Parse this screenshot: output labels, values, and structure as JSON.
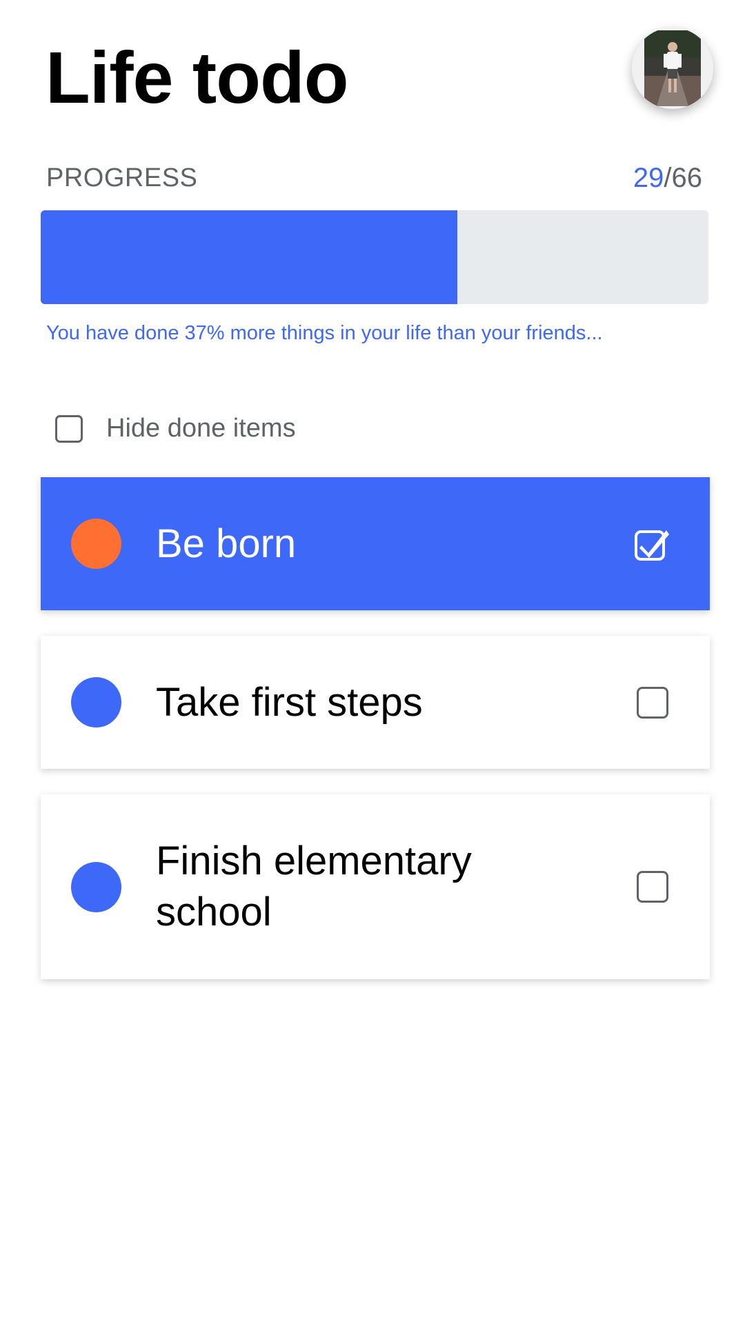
{
  "header": {
    "title": "Life todo",
    "avatar_icon": "user-avatar-photo"
  },
  "progress": {
    "label": "PROGRESS",
    "done": "29",
    "separator": "/",
    "total": "66",
    "fraction": 0.6237,
    "note": "You have done 37% more things in your life than your friends...",
    "fill_color": "#3d68f8",
    "track_color": "#e8ebee"
  },
  "filter": {
    "hide_done_label": "Hide done items",
    "checked": false
  },
  "todos": [
    {
      "title": "Be born",
      "done": true,
      "dot_color": "#fd7032",
      "check_icon": "checked-checkbox-icon"
    },
    {
      "title": "Take first steps",
      "done": false,
      "dot_color": "#3d68f8",
      "check_icon": "empty-checkbox-icon"
    },
    {
      "title": "Finish elementary school",
      "done": false,
      "dot_color": "#3d68f8",
      "check_icon": "empty-checkbox-icon"
    }
  ],
  "colors": {
    "accent": "#3d68f8",
    "highlight_dot": "#fd7032",
    "muted_text": "#5f6368"
  }
}
